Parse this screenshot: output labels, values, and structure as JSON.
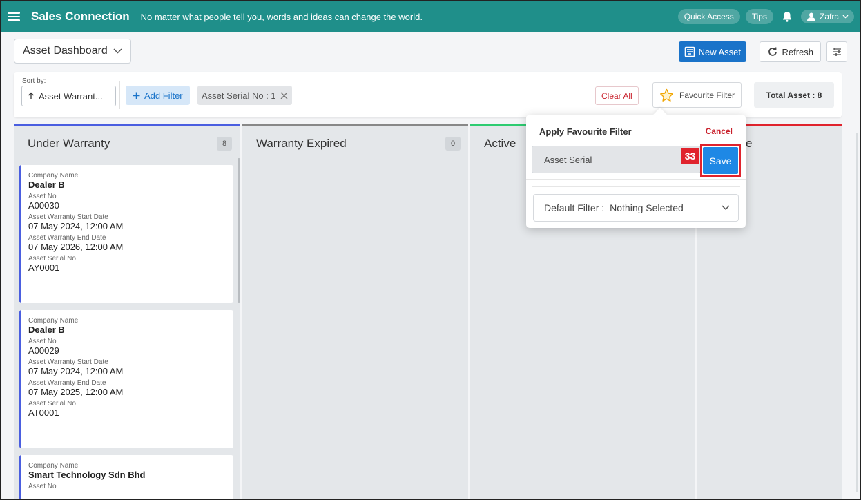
{
  "app": {
    "brand": "Sales Connection",
    "tagline": "No matter what people tell you, words and ideas can change the world.",
    "quick_access": "Quick Access",
    "tips": "Tips",
    "user": "Zafra"
  },
  "header": {
    "dashboard_select": "Asset Dashboard",
    "new_asset": "New Asset",
    "refresh": "Refresh"
  },
  "filters": {
    "sort_label": "Sort by:",
    "sort_value": "Asset Warrant...",
    "add_filter": "Add Filter",
    "chip": "Asset Serial No : 1",
    "clear_all": "Clear All",
    "favourite_filter": "Favourite Filter",
    "total_asset": "Total Asset : 8"
  },
  "columns": [
    {
      "title": "Under Warranty",
      "count": "8",
      "color": "#4a5ee0"
    },
    {
      "title": "Warranty Expired",
      "count": "0",
      "color": "#888888"
    },
    {
      "title": "Active",
      "count": "",
      "color": "#2ecc71"
    },
    {
      "title": "e",
      "count": "",
      "color": "#e0232d"
    }
  ],
  "cards": [
    {
      "company_label": "Company Name",
      "company": "Dealer B",
      "asset_no_label": "Asset No",
      "asset_no": "A00030",
      "start_label": "Asset Warranty Start Date",
      "start": "07 May 2024, 12:00 AM",
      "end_label": "Asset Warranty End Date",
      "end": "07 May 2026, 12:00 AM",
      "serial_label": "Asset Serial No",
      "serial": "AY0001"
    },
    {
      "company_label": "Company Name",
      "company": "Dealer B",
      "asset_no_label": "Asset No",
      "asset_no": "A00029",
      "start_label": "Asset Warranty Start Date",
      "start": "07 May 2024, 12:00 AM",
      "end_label": "Asset Warranty End Date",
      "end": "07 May 2025, 12:00 AM",
      "serial_label": "Asset Serial No",
      "serial": "AT0001"
    },
    {
      "company_label": "Company Name",
      "company": "Smart Technology Sdn Bhd",
      "asset_no_label": "Asset No"
    }
  ],
  "popup": {
    "title": "Apply Favourite Filter",
    "cancel": "Cancel",
    "input_value": "Asset Serial",
    "step_badge": "33",
    "save": "Save",
    "default_filter_label": "Default Filter :",
    "default_filter_value": "Nothing Selected"
  }
}
